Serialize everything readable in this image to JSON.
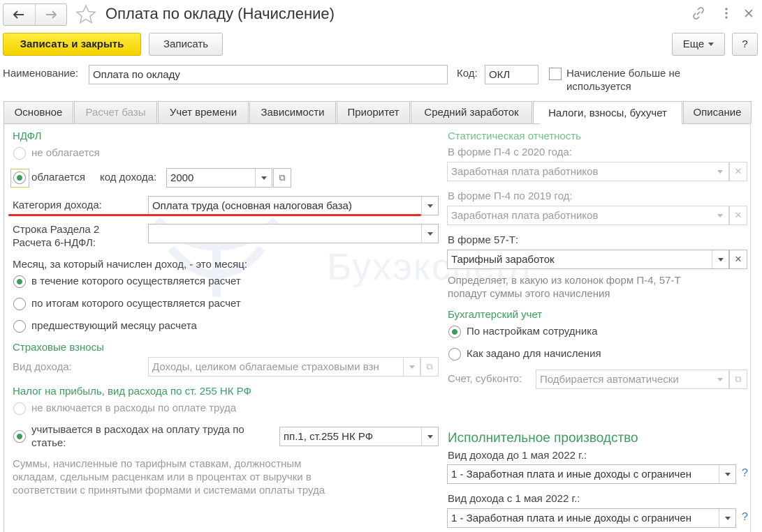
{
  "window": {
    "title": "Оплата по окладу (Начисление)"
  },
  "toolbar": {
    "save_close": "Записать и закрыть",
    "save": "Записать",
    "more": "Еще",
    "help": "?"
  },
  "header": {
    "name_label": "Наименование:",
    "name_value": "Оплата по окладу",
    "code_label": "Код:",
    "code_value": "ОКЛ",
    "not_used_label_1": "Начисление больше не",
    "not_used_label_2": "используется"
  },
  "tabs": [
    {
      "label": "Основное"
    },
    {
      "label": "Расчет базы"
    },
    {
      "label": "Учет времени"
    },
    {
      "label": "Зависимости"
    },
    {
      "label": "Приоритет"
    },
    {
      "label": "Средний заработок"
    },
    {
      "label": "Налоги, взносы, бухучет"
    },
    {
      "label": "Описание"
    }
  ],
  "left": {
    "ndfl_header": "НДФЛ",
    "not_taxed": "не облагается",
    "taxed": "облагается",
    "income_code_label": "код дохода:",
    "income_code_value": "2000",
    "income_category_label": "Категория дохода:",
    "income_category_value": "Оплата труда (основная налоговая база)",
    "section_line_label_1": "Строка Раздела 2",
    "section_line_label_2": "Расчета 6-НДФЛ:",
    "section_line_value": "",
    "month_question": "Месяц, за который начислен доход, - это месяц:",
    "month_opt_1": "в течение которого осуществляется расчет",
    "month_opt_2": "по итогам которого осуществляется расчет",
    "month_opt_3": "предшествующий месяцу расчета",
    "insurance_header": "Страховые взносы",
    "income_type_label": "Вид дохода:",
    "income_type_value": "Доходы, целиком облагаемые страховыми взн",
    "profit_tax_header": "Налог на прибыль, вид расхода по ст. 255 НК РФ",
    "profit_opt_1": "не включается в расходы по оплате труда",
    "profit_opt_2_line_1": "учитывается в расходах на оплату труда по",
    "profit_opt_2_line_2": "статье:",
    "profit_article_value": "пп.1, ст.255 НК РФ",
    "note_1": "Суммы, начисленные по тарифным ставкам, должностным",
    "note_2": "окладам, сдельным расценкам или в процентах от выручки в",
    "note_3": "соответствии с принятыми формами и системами оплаты труда"
  },
  "right": {
    "stat_header": "Статистическая отчетность",
    "p4_2020_label": "В форме П-4 с 2020 года:",
    "p4_2020_value": "Заработная плата работников",
    "p4_2019_label": "В форме П-4 по 2019 год:",
    "p4_2019_value": "Заработная плата работников",
    "f57_label": "В форме 57-Т:",
    "f57_value": "Тарифный заработок",
    "stat_note_1": "Определяет, в какую из колонок форм П-4, 57-Т",
    "stat_note_2": "попадут суммы этого начисления",
    "accounting_header": "Бухгалтерский учет",
    "acc_opt_1": "По настройкам сотрудника",
    "acc_opt_2": "Как задано для начисления",
    "account_label": "Счет, субконто:",
    "account_value": "Подбирается автоматически",
    "enforcement_header": "Исполнительное производство",
    "before_label": "Вид дохода до 1 мая 2022 г.:",
    "before_value": "1 - Заработная плата и иные доходы с ограничен",
    "after_label": "Вид дохода с 1 мая 2022 г.:",
    "after_value": "1 - Заработная плата и иные доходы с ограничен",
    "help_q": "?"
  },
  "watermark": "Бухэксперт",
  "colors": {
    "accent_green": "#3c9c5e",
    "primary_button": "#f5d200",
    "underline_red": "#e0302b",
    "help_blue": "#3a77c0"
  }
}
